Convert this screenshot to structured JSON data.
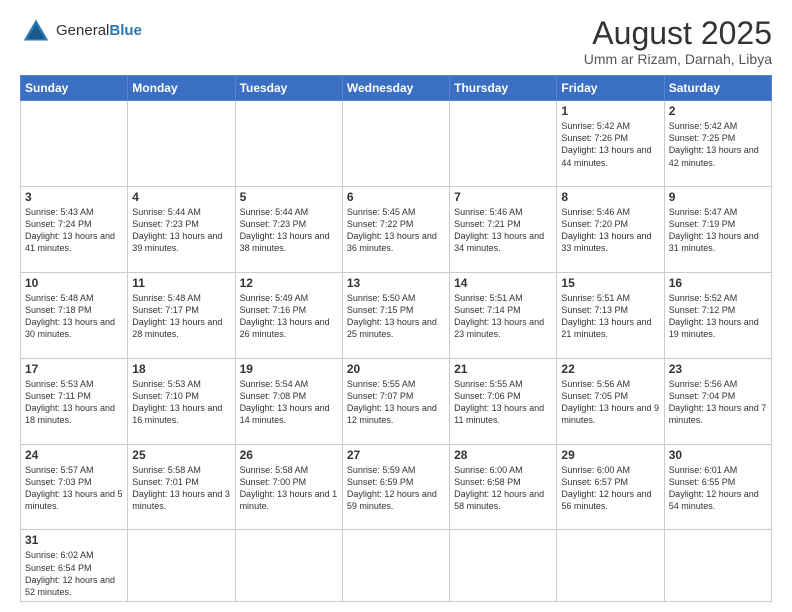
{
  "header": {
    "logo_text_normal": "General",
    "logo_text_bold": "Blue",
    "title": "August 2025",
    "subtitle": "Umm ar Rizam, Darnah, Libya"
  },
  "calendar": {
    "day_headers": [
      "Sunday",
      "Monday",
      "Tuesday",
      "Wednesday",
      "Thursday",
      "Friday",
      "Saturday"
    ],
    "weeks": [
      [
        {
          "day": "",
          "info": ""
        },
        {
          "day": "",
          "info": ""
        },
        {
          "day": "",
          "info": ""
        },
        {
          "day": "",
          "info": ""
        },
        {
          "day": "",
          "info": ""
        },
        {
          "day": "1",
          "info": "Sunrise: 5:42 AM\nSunset: 7:26 PM\nDaylight: 13 hours and 44 minutes."
        },
        {
          "day": "2",
          "info": "Sunrise: 5:42 AM\nSunset: 7:25 PM\nDaylight: 13 hours and 42 minutes."
        }
      ],
      [
        {
          "day": "3",
          "info": "Sunrise: 5:43 AM\nSunset: 7:24 PM\nDaylight: 13 hours and 41 minutes."
        },
        {
          "day": "4",
          "info": "Sunrise: 5:44 AM\nSunset: 7:23 PM\nDaylight: 13 hours and 39 minutes."
        },
        {
          "day": "5",
          "info": "Sunrise: 5:44 AM\nSunset: 7:23 PM\nDaylight: 13 hours and 38 minutes."
        },
        {
          "day": "6",
          "info": "Sunrise: 5:45 AM\nSunset: 7:22 PM\nDaylight: 13 hours and 36 minutes."
        },
        {
          "day": "7",
          "info": "Sunrise: 5:46 AM\nSunset: 7:21 PM\nDaylight: 13 hours and 34 minutes."
        },
        {
          "day": "8",
          "info": "Sunrise: 5:46 AM\nSunset: 7:20 PM\nDaylight: 13 hours and 33 minutes."
        },
        {
          "day": "9",
          "info": "Sunrise: 5:47 AM\nSunset: 7:19 PM\nDaylight: 13 hours and 31 minutes."
        }
      ],
      [
        {
          "day": "10",
          "info": "Sunrise: 5:48 AM\nSunset: 7:18 PM\nDaylight: 13 hours and 30 minutes."
        },
        {
          "day": "11",
          "info": "Sunrise: 5:48 AM\nSunset: 7:17 PM\nDaylight: 13 hours and 28 minutes."
        },
        {
          "day": "12",
          "info": "Sunrise: 5:49 AM\nSunset: 7:16 PM\nDaylight: 13 hours and 26 minutes."
        },
        {
          "day": "13",
          "info": "Sunrise: 5:50 AM\nSunset: 7:15 PM\nDaylight: 13 hours and 25 minutes."
        },
        {
          "day": "14",
          "info": "Sunrise: 5:51 AM\nSunset: 7:14 PM\nDaylight: 13 hours and 23 minutes."
        },
        {
          "day": "15",
          "info": "Sunrise: 5:51 AM\nSunset: 7:13 PM\nDaylight: 13 hours and 21 minutes."
        },
        {
          "day": "16",
          "info": "Sunrise: 5:52 AM\nSunset: 7:12 PM\nDaylight: 13 hours and 19 minutes."
        }
      ],
      [
        {
          "day": "17",
          "info": "Sunrise: 5:53 AM\nSunset: 7:11 PM\nDaylight: 13 hours and 18 minutes."
        },
        {
          "day": "18",
          "info": "Sunrise: 5:53 AM\nSunset: 7:10 PM\nDaylight: 13 hours and 16 minutes."
        },
        {
          "day": "19",
          "info": "Sunrise: 5:54 AM\nSunset: 7:08 PM\nDaylight: 13 hours and 14 minutes."
        },
        {
          "day": "20",
          "info": "Sunrise: 5:55 AM\nSunset: 7:07 PM\nDaylight: 13 hours and 12 minutes."
        },
        {
          "day": "21",
          "info": "Sunrise: 5:55 AM\nSunset: 7:06 PM\nDaylight: 13 hours and 11 minutes."
        },
        {
          "day": "22",
          "info": "Sunrise: 5:56 AM\nSunset: 7:05 PM\nDaylight: 13 hours and 9 minutes."
        },
        {
          "day": "23",
          "info": "Sunrise: 5:56 AM\nSunset: 7:04 PM\nDaylight: 13 hours and 7 minutes."
        }
      ],
      [
        {
          "day": "24",
          "info": "Sunrise: 5:57 AM\nSunset: 7:03 PM\nDaylight: 13 hours and 5 minutes."
        },
        {
          "day": "25",
          "info": "Sunrise: 5:58 AM\nSunset: 7:01 PM\nDaylight: 13 hours and 3 minutes."
        },
        {
          "day": "26",
          "info": "Sunrise: 5:58 AM\nSunset: 7:00 PM\nDaylight: 13 hours and 1 minute."
        },
        {
          "day": "27",
          "info": "Sunrise: 5:59 AM\nSunset: 6:59 PM\nDaylight: 12 hours and 59 minutes."
        },
        {
          "day": "28",
          "info": "Sunrise: 6:00 AM\nSunset: 6:58 PM\nDaylight: 12 hours and 58 minutes."
        },
        {
          "day": "29",
          "info": "Sunrise: 6:00 AM\nSunset: 6:57 PM\nDaylight: 12 hours and 56 minutes."
        },
        {
          "day": "30",
          "info": "Sunrise: 6:01 AM\nSunset: 6:55 PM\nDaylight: 12 hours and 54 minutes."
        }
      ],
      [
        {
          "day": "31",
          "info": "Sunrise: 6:02 AM\nSunset: 6:54 PM\nDaylight: 12 hours and 52 minutes."
        },
        {
          "day": "",
          "info": ""
        },
        {
          "day": "",
          "info": ""
        },
        {
          "day": "",
          "info": ""
        },
        {
          "day": "",
          "info": ""
        },
        {
          "day": "",
          "info": ""
        },
        {
          "day": "",
          "info": ""
        }
      ]
    ]
  }
}
